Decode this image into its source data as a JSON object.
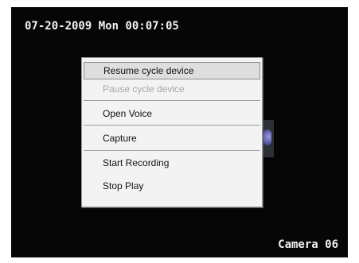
{
  "overlay": {
    "timestamp": "07-20-2009 Mon 00:07:05",
    "camera_label": "Camera 06"
  },
  "context_menu": {
    "items": [
      {
        "label": "Resume cycle device",
        "state": "highlighted"
      },
      {
        "label": "Pause cycle device",
        "state": "disabled"
      },
      {
        "label": "Open Voice",
        "state": "enabled"
      },
      {
        "label": "Capture",
        "state": "enabled"
      },
      {
        "label": "Start Recording",
        "state": "enabled"
      },
      {
        "label": "Stop Play",
        "state": "enabled"
      }
    ]
  },
  "colors": {
    "video_background": "#060606",
    "overlay_text": "#f2f2f2",
    "menu_background": "#f3f3f3",
    "highlight_background": "#dedede",
    "disabled_text": "#a7a7a7"
  }
}
